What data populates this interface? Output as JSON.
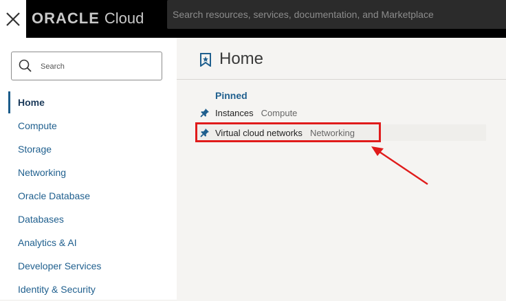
{
  "topbar": {
    "logo_oracle": "ORACLE",
    "logo_cloud": "Cloud",
    "search_placeholder": "Search resources, services, documentation, and Marketplace"
  },
  "sidebar": {
    "search_placeholder": "Search",
    "items": [
      {
        "label": "Home",
        "active": true
      },
      {
        "label": "Compute"
      },
      {
        "label": "Storage"
      },
      {
        "label": "Networking"
      },
      {
        "label": "Oracle Database"
      },
      {
        "label": "Databases"
      },
      {
        "label": "Analytics & AI"
      },
      {
        "label": "Developer Services"
      },
      {
        "label": "Identity & Security"
      }
    ]
  },
  "main": {
    "title": "Home",
    "pinned_title": "Pinned",
    "pinned": [
      {
        "name": "Instances",
        "category": "Compute"
      },
      {
        "name": "Virtual cloud networks",
        "category": "Networking"
      }
    ]
  },
  "colors": {
    "accent": "#1f5f8e",
    "annotation": "#e01b1b"
  }
}
